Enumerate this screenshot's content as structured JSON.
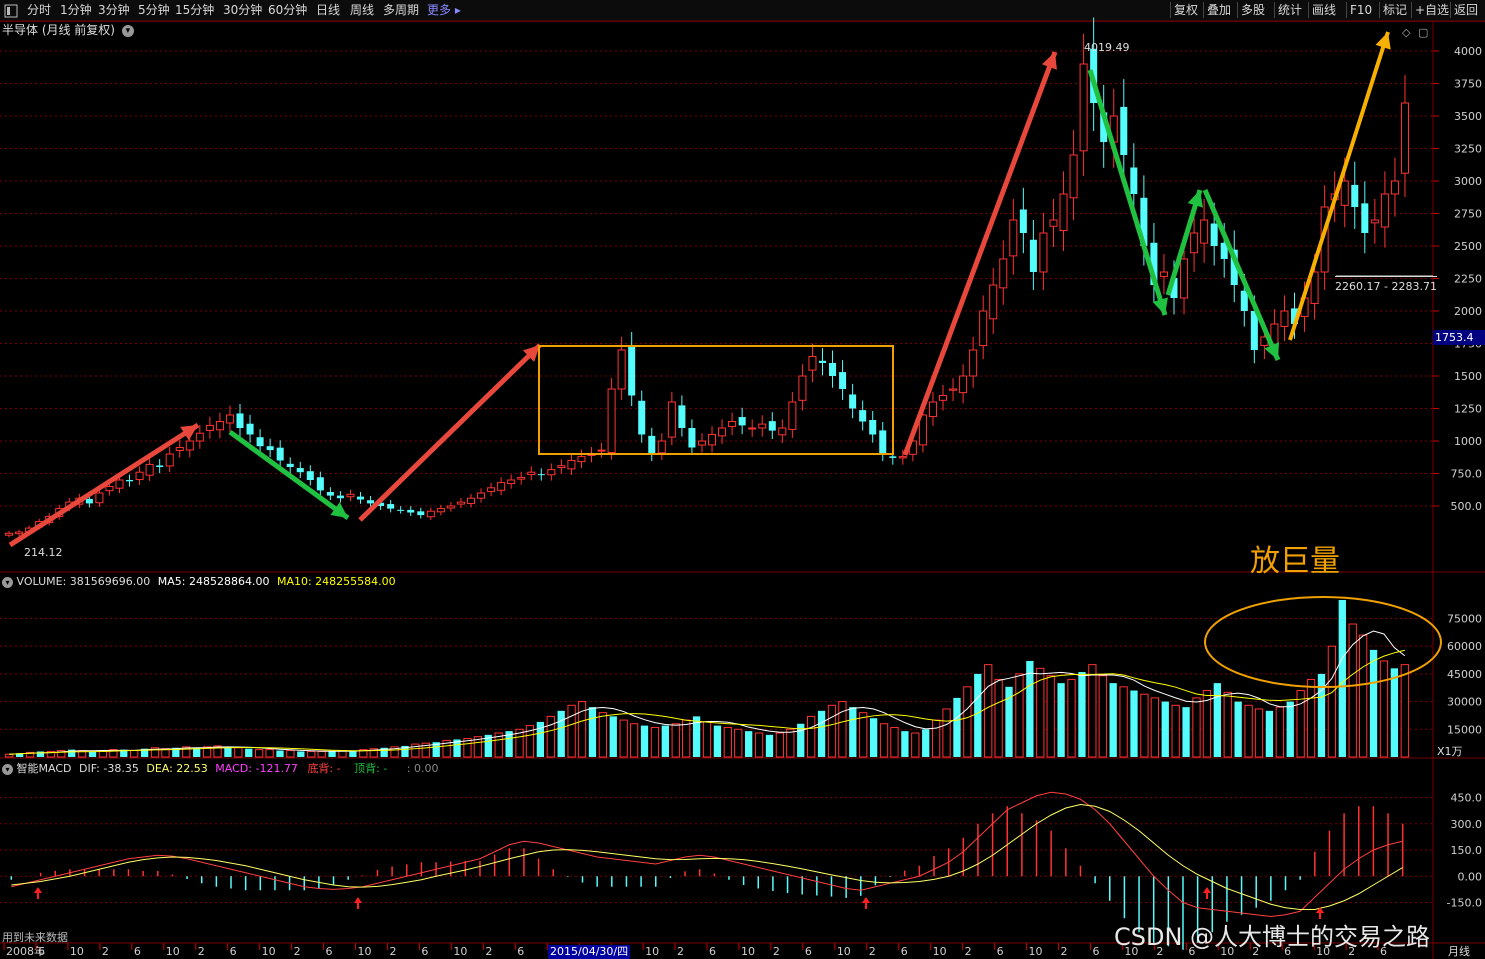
{
  "toolbar": {
    "left_icon": "panel-icon",
    "periods": [
      "分时",
      "1分钟",
      "3分钟",
      "5分钟",
      "15分钟",
      "30分钟",
      "60分钟",
      "日线",
      "周线",
      "多周期",
      "更多"
    ],
    "right_items": [
      "复权",
      "叠加",
      "多股",
      "统计",
      "画线",
      "F10",
      "标记",
      "+自选",
      "返回"
    ]
  },
  "header": {
    "title": "半导体 (月线 前复权)",
    "corner_icons": [
      "diamond-icon",
      "square-icon"
    ]
  },
  "price_panel": {
    "y_ticks": [
      "4000",
      "3750",
      "3500",
      "3250",
      "3000",
      "2750",
      "2500",
      "2250",
      "2000",
      "1750",
      "1500",
      "1250",
      "1000",
      "750.0",
      "500.0"
    ],
    "high_label": "4019.49",
    "low_label": "214.12",
    "current_price_flag": "1753.4",
    "range_label": "2260.17 - 2283.71",
    "annotation": "放巨量"
  },
  "volume_panel": {
    "legend_name": "VOLUME: 381569696.00",
    "legend_ma5": "MA5: 248528864.00",
    "legend_ma10": "MA10: 248255584.00",
    "y_ticks": [
      "75000",
      "60000",
      "45000",
      "30000",
      "15000"
    ],
    "unit": "X1万"
  },
  "macd_panel": {
    "legend_name": "智能MACD",
    "legend_dif": "DIF: -38.35",
    "legend_dea": "DEA: 22.53",
    "legend_macd": "MACD: -121.77",
    "legend_di": "底背: -",
    "legend_ding": "顶背: -",
    "legend_extra": ": 0.00",
    "y_ticks": [
      "450.0",
      "300.0",
      "150.0",
      "0.00",
      "-150.0"
    ]
  },
  "x_axis": {
    "labels": [
      "2008年",
      "6",
      "10",
      "2",
      "6",
      "10",
      "2",
      "6",
      "10",
      "2",
      "6",
      "10",
      "2",
      "6",
      "10",
      "2",
      "6",
      "10",
      "2",
      "6",
      "10",
      "2",
      "6",
      "10",
      "2",
      "6",
      "10",
      "2",
      "6",
      "10",
      "2",
      "6",
      "10",
      "2",
      "6",
      "10",
      "2",
      "6",
      "10",
      "2",
      "6",
      "10",
      "2",
      "6"
    ],
    "highlight_date": "2015/04/30/四",
    "period_label": "月线"
  },
  "footer_note": "用到未来数据",
  "watermark": "CSDN @人大博士的交易之路",
  "colors": {
    "up": "#ff3232",
    "down": "#54fcfc",
    "ma5": "#ffffff",
    "ma10": "#ffff00",
    "dif": "#ff4040",
    "dea": "#ffff66",
    "grid": "#7a0000",
    "box": "#f0a000",
    "arrow_up": "#e8483c",
    "arrow_down": "#20c040",
    "arrow_final": "#f8b000"
  },
  "chart_data": [
    {
      "type": "candlestick",
      "title": "半导体 (月线 前复权)",
      "ylim": [
        200,
        4100
      ],
      "series": [
        {
          "name": "半导体",
          "close": [
            290,
            300,
            330,
            380,
            420,
            480,
            530,
            560,
            520,
            600,
            650,
            700,
            690,
            760,
            820,
            800,
            900,
            950,
            1000,
            1060,
            1120,
            1150,
            1200,
            1100,
            1050,
            960,
            930,
            850,
            800,
            760,
            700,
            620,
            580,
            560,
            590,
            550,
            520,
            500,
            480,
            470,
            450,
            430,
            460,
            480,
            500,
            530,
            560,
            600,
            640,
            680,
            700,
            720,
            760,
            740,
            780,
            810,
            850,
            880,
            900,
            930,
            1400,
            1700,
            1350,
            1050,
            900,
            1000,
            1300,
            1100,
            950,
            1000,
            1050,
            1100,
            1150,
            1120,
            1100,
            1130,
            1080,
            1100,
            1300,
            1500,
            1650,
            1600,
            1500,
            1400,
            1250,
            1150,
            1050,
            900,
            870,
            880,
            1000,
            1200,
            1300,
            1350,
            1400,
            1500,
            1700,
            2000,
            2200,
            2400,
            2700,
            2600,
            2300,
            2600,
            2700,
            2900,
            3200,
            3900,
            3600,
            3300,
            3500,
            3200,
            2900,
            2500,
            2200,
            2300,
            2100,
            2400,
            2600,
            2700,
            2500,
            2400,
            2200,
            2000,
            1700,
            1800,
            1900,
            2000,
            1900,
            2100,
            2300,
            2800,
            2900,
            3000,
            2800,
            2600,
            2700,
            2900,
            3000,
            3600
          ],
          "unit": "index points"
        }
      ]
    },
    {
      "type": "bar",
      "title": "VOLUME",
      "ylim": [
        0,
        85000
      ],
      "unit": "X1万",
      "series": [
        {
          "name": "VOLUME",
          "values": [
            1500,
            2000,
            2500,
            3000,
            3000,
            3500,
            4000,
            3500,
            3000,
            3500,
            4000,
            4000,
            3500,
            4500,
            5000,
            4500,
            5000,
            5500,
            5000,
            5500,
            6000,
            5500,
            5000,
            4500,
            4000,
            4000,
            3500,
            3500,
            3000,
            3000,
            3000,
            3000,
            3500,
            3500,
            4000,
            4500,
            5000,
            5500,
            6000,
            7000,
            7500,
            8000,
            9000,
            9500,
            10000,
            11000,
            12000,
            13000,
            14000,
            15000,
            17000,
            19000,
            22000,
            25000,
            28000,
            30000,
            27000,
            24000,
            22000,
            20000,
            18000,
            17000,
            16000,
            17000,
            18000,
            20000,
            22000,
            19000,
            17000,
            16000,
            15000,
            14000,
            13000,
            12000,
            13000,
            15000,
            18000,
            22000,
            25000,
            28000,
            30000,
            27000,
            24000,
            21000,
            18000,
            16000,
            14000,
            13000,
            15000,
            20000,
            26000,
            32000,
            38000,
            45000,
            50000,
            42000,
            38000,
            45000,
            52000,
            48000,
            44000,
            40000,
            42000,
            46000,
            50000,
            44000,
            40000,
            38000,
            36000,
            34000,
            32000,
            30000,
            28000,
            27000,
            32000,
            36000,
            40000,
            35000,
            30000,
            28000,
            26000,
            25000,
            27000,
            30000,
            36000,
            42000,
            45000,
            60000,
            85000,
            72000,
            66000,
            58000,
            52000,
            48000,
            50000
          ]
        },
        {
          "name": "MA5",
          "values": []
        },
        {
          "name": "MA10",
          "values": []
        }
      ]
    },
    {
      "type": "line",
      "title": "智能MACD",
      "ylim": [
        -250,
        550
      ],
      "series": [
        {
          "name": "DIF",
          "values": [
            -60,
            -40,
            -20,
            0,
            20,
            40,
            60,
            80,
            100,
            110,
            120,
            115,
            100,
            80,
            60,
            40,
            20,
            0,
            -20,
            -40,
            -60,
            -70,
            -75,
            -70,
            -60,
            -40,
            -20,
            0,
            20,
            40,
            60,
            80,
            100,
            140,
            180,
            200,
            190,
            170,
            150,
            130,
            110,
            100,
            90,
            80,
            70,
            90,
            110,
            120,
            110,
            90,
            70,
            50,
            30,
            10,
            -10,
            -30,
            -50,
            -70,
            -80,
            -60,
            -40,
            -20,
            0,
            40,
            80,
            140,
            220,
            300,
            380,
            420,
            460,
            480,
            470,
            440,
            380,
            300,
            200,
            100,
            0,
            -80,
            -150,
            -180,
            -190,
            -200,
            -210,
            -220,
            -230,
            -220,
            -200,
            -120,
            -40,
            40,
            100,
            150,
            180,
            200
          ]
        },
        {
          "name": "DEA",
          "values": [
            -50,
            -40,
            -30,
            -15,
            0,
            20,
            40,
            60,
            80,
            95,
            105,
            110,
            108,
            100,
            90,
            75,
            60,
            40,
            20,
            0,
            -20,
            -35,
            -50,
            -60,
            -62,
            -58,
            -48,
            -34,
            -20,
            0,
            18,
            36,
            56,
            78,
            100,
            120,
            140,
            150,
            152,
            148,
            140,
            130,
            120,
            110,
            100,
            95,
            96,
            100,
            102,
            100,
            95,
            85,
            72,
            58,
            42,
            25,
            8,
            -8,
            -24,
            -34,
            -38,
            -36,
            -30,
            -18,
            0,
            30,
            70,
            120,
            180,
            240,
            300,
            350,
            390,
            410,
            400,
            370,
            320,
            260,
            190,
            120,
            60,
            10,
            -30,
            -70,
            -100,
            -130,
            -160,
            -180,
            -190,
            -190,
            -170,
            -140,
            -100,
            -50,
            0,
            50,
            100
          ]
        },
        {
          "name": "MACD",
          "values": []
        }
      ]
    }
  ]
}
